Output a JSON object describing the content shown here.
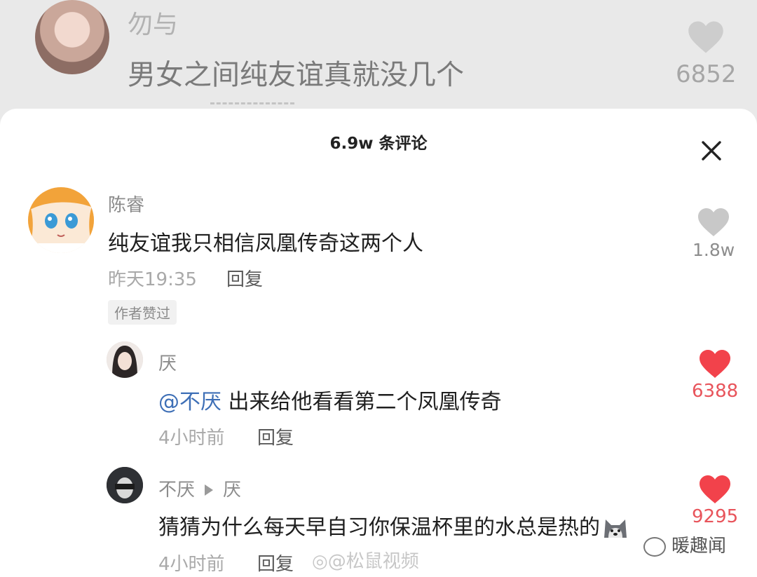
{
  "background_post": {
    "username": "勿与",
    "text": "男女之间纯友谊真就没几个",
    "likes": "6852"
  },
  "sheet": {
    "title": "6.9w 条评论"
  },
  "comments": [
    {
      "username": "陈睿",
      "text": "纯友谊我只相信凤凰传奇这两个人",
      "time": "昨天19:35",
      "reply_label": "回复",
      "badge": "作者赞过",
      "likes": "1.8w",
      "liked": false
    },
    {
      "username": "厌",
      "mention": "@不厌",
      "text": " 出来给他看看第二个凤凰传奇",
      "time": "4小时前",
      "reply_label": "回复",
      "likes": "6388",
      "liked": true
    },
    {
      "username": "不厌",
      "reply_to": "厌",
      "text": "猜猜为什么每天早自习你保温杯里的水总是热的",
      "time": "4小时前",
      "reply_label": "回复",
      "likes": "9295",
      "liked": true
    }
  ],
  "watermark": "@松鼠视频",
  "brand": "暖趣闻",
  "colors": {
    "liked_heart": "#f2424b",
    "unliked_heart": "#c8c8c8",
    "mention": "#3e6fb6"
  }
}
